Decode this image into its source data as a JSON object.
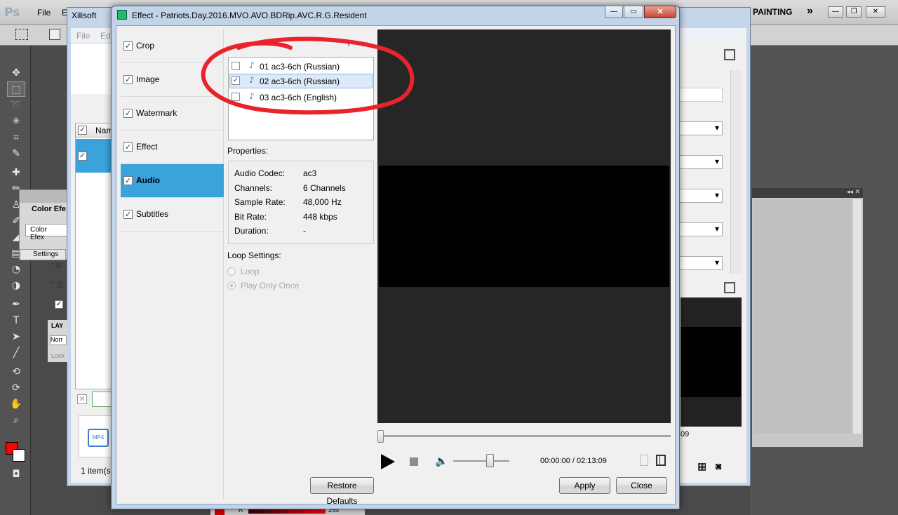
{
  "photoshop": {
    "logo": "Ps",
    "menu_file": "File",
    "menu_edit_partial": "E",
    "workspace": "PAINTING",
    "overflow": "»",
    "color_panel_title": "Color Efe",
    "color_panel_button": "Color Efex",
    "settings_tab": "Settings",
    "layers_label": "LAY",
    "blend_partial": "Norr",
    "lock_partial": "Lock",
    "foreground_color": "#ff0000",
    "color_value_label": "R",
    "color_value": "255"
  },
  "xilisoft": {
    "title": "Xilisoft",
    "menu_file": "File",
    "menu_edit": "Edi",
    "col_name_partial": "Nam",
    "status_count": "1 item(s",
    "time_partial": "09"
  },
  "dialog": {
    "title": "Effect - Patriots.Day.2016.MVO.AVO.BDRip.AVC.R.G.Resident",
    "nav": [
      {
        "label": "Crop",
        "checked": true
      },
      {
        "label": "Image",
        "checked": true
      },
      {
        "label": "Watermark",
        "checked": true
      },
      {
        "label": "Effect",
        "checked": true
      },
      {
        "label": "Audio",
        "checked": true
      },
      {
        "label": "Subtitles",
        "checked": true
      }
    ],
    "active_nav": "Audio",
    "tracks": [
      {
        "label": "01 ac3-6ch (Russian)",
        "checked": false
      },
      {
        "label": "02 ac3-6ch (Russian)",
        "checked": true
      },
      {
        "label": "03 ac3-6ch (English)",
        "checked": false
      }
    ],
    "properties_title": "Properties:",
    "properties": [
      {
        "key": "Audio Codec:",
        "value": "ac3"
      },
      {
        "key": "Channels:",
        "value": "6 Channels"
      },
      {
        "key": "Sample Rate:",
        "value": "48,000 Hz"
      },
      {
        "key": "Bit Rate:",
        "value": "448 kbps"
      },
      {
        "key": "Duration:",
        "value": "-"
      }
    ],
    "loop_title": "Loop Settings:",
    "loop_options": [
      {
        "label": "Loop",
        "selected": false
      },
      {
        "label": "Play Only Once",
        "selected": true
      }
    ],
    "time": "00:00:00 / 02:13:09",
    "buttons": {
      "restore": "Restore Defaults",
      "apply": "Apply",
      "close": "Close"
    },
    "annotation_color": "#e8232b"
  }
}
